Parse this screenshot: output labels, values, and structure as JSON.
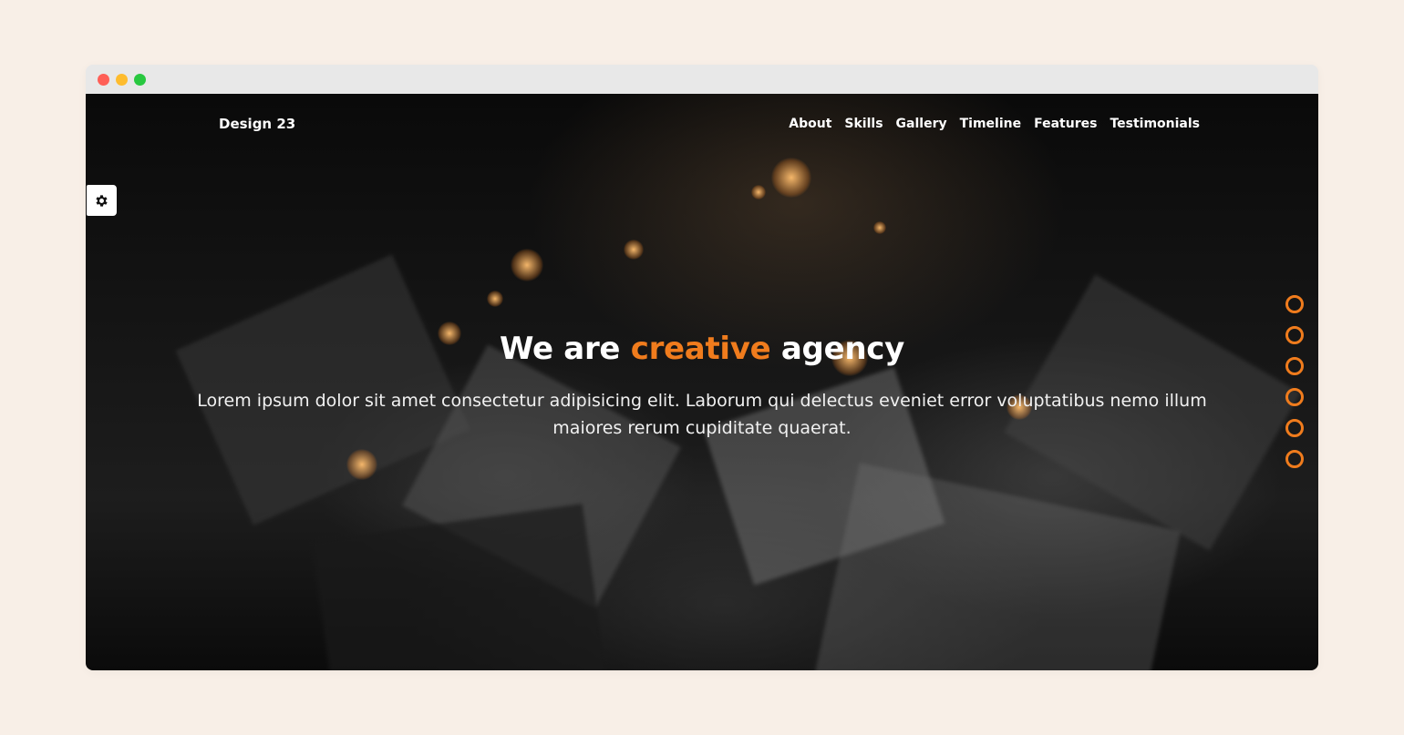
{
  "window": {
    "controls": [
      "close",
      "minimize",
      "maximize"
    ]
  },
  "navbar": {
    "brand": "Design 23",
    "links": [
      "About",
      "Skills",
      "Gallery",
      "Timeline",
      "Features",
      "Testimonials"
    ]
  },
  "settings": {
    "icon": "gear-icon"
  },
  "hero": {
    "title_start": "We are ",
    "title_accent": "creative",
    "title_end": " agency",
    "description": "Lorem ipsum dolor sit amet consectetur adipisicing elit. Laborum qui delectus eveniet error voluptatibus nemo illum maiores rerum cupiditate quaerat."
  },
  "section_dots": {
    "count": 6
  },
  "colors": {
    "accent": "#f07c1d",
    "page_background": "#f8efe7",
    "titlebar": "#e8e8e8"
  }
}
